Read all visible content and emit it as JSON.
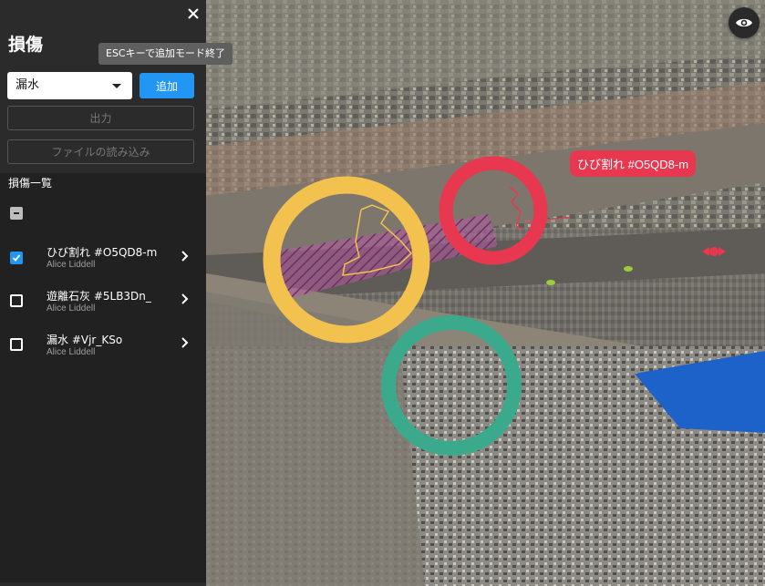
{
  "panel": {
    "title": "損傷",
    "tooltip": "ESCキーで追加モード終了",
    "type_select": {
      "value": "漏水"
    },
    "add_label": "追加",
    "export_label": "出力",
    "import_label": "ファイルの読み込み",
    "list_heading": "損傷一覧",
    "items": [
      {
        "title": "ひび割れ #O5QD8-m",
        "author": "Alice Liddell",
        "checked": true
      },
      {
        "title": "遊離石灰 #5LB3Dn_",
        "author": "Alice Liddell",
        "checked": false
      },
      {
        "title": "漏水 #Vjr_KSo",
        "author": "Alice Liddell",
        "checked": false
      }
    ]
  },
  "viewport": {
    "label": "ひび割れ #O5QD8-m",
    "ring_colors": {
      "yellow": "#f2c14e",
      "red": "#e8384f",
      "green": "#3aa98c"
    },
    "label_color": "#e8384f",
    "accent": "#2196f3"
  }
}
